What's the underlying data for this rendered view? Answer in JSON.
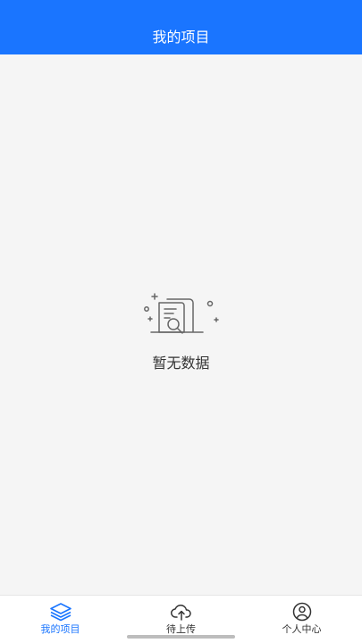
{
  "header": {
    "title": "我的项目"
  },
  "empty_state": {
    "message": "暂无数据",
    "icon": "document-search-icon"
  },
  "tabs": [
    {
      "label": "我的项目",
      "icon": "layers-icon",
      "active": true
    },
    {
      "label": "待上传",
      "icon": "cloud-upload-icon",
      "active": false
    },
    {
      "label": "个人中心",
      "icon": "user-circle-icon",
      "active": false
    }
  ],
  "colors": {
    "primary": "#1a75ff",
    "background": "#f5f5f5",
    "text": "#333333"
  }
}
